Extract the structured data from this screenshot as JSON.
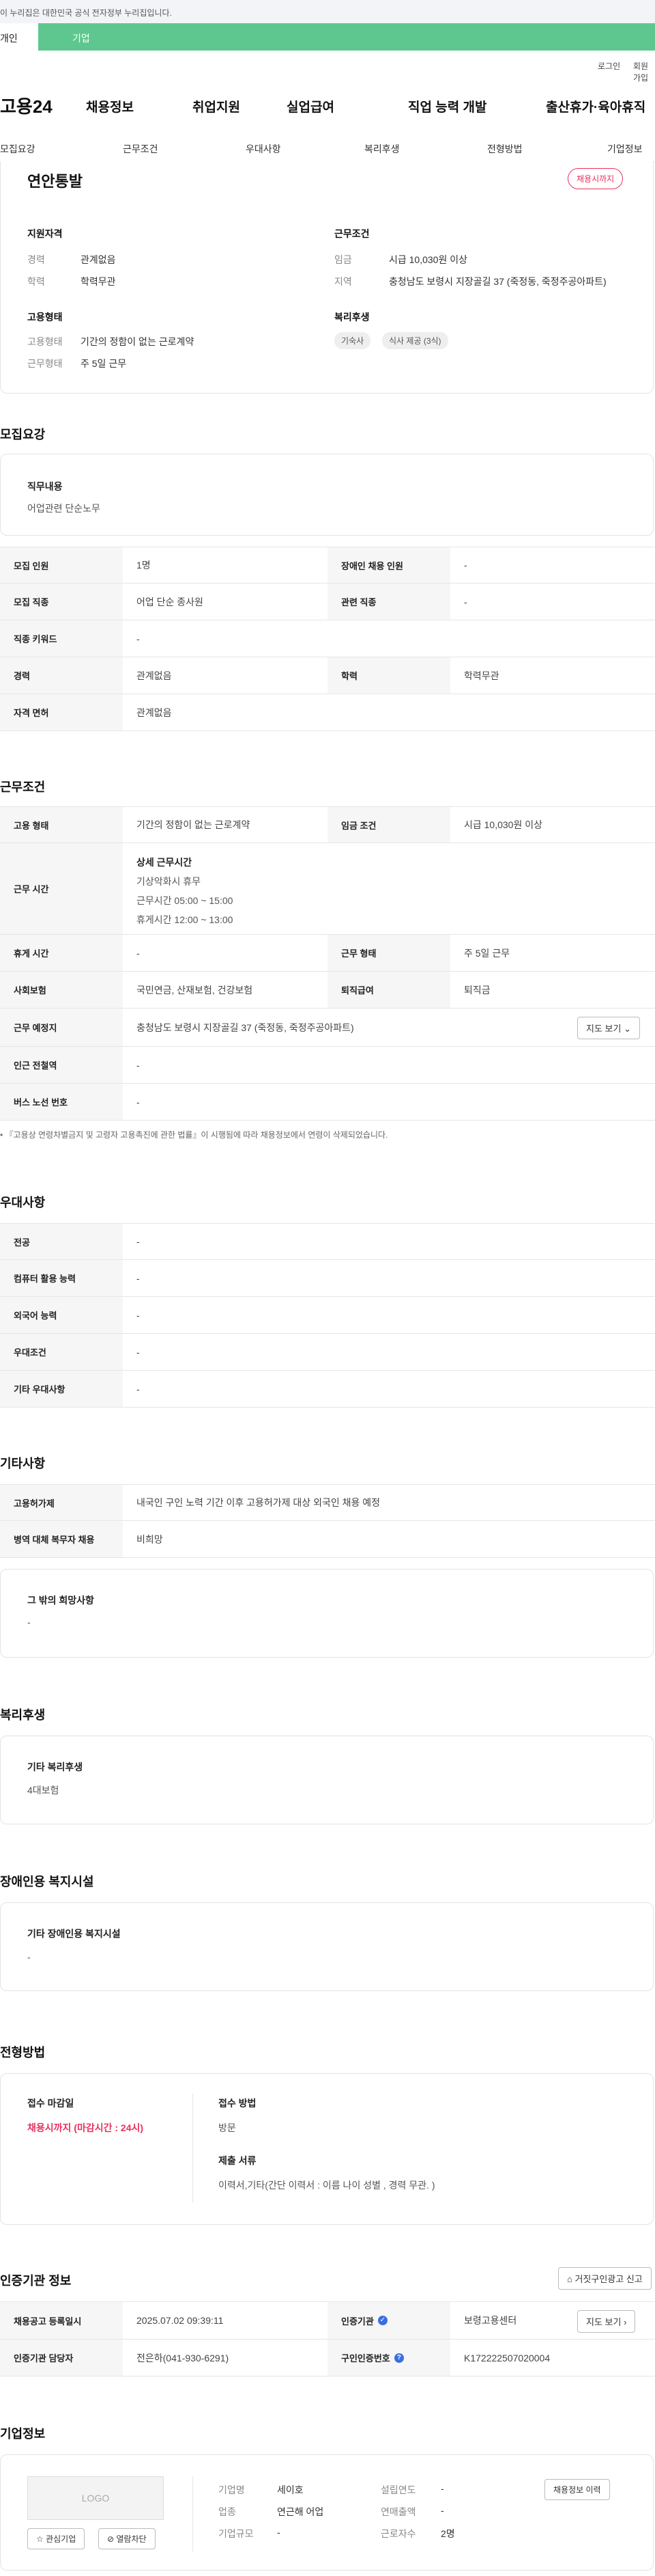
{
  "gov_banner": "이 누리집은 대한민국 공식 전자정부 누리집입니다.",
  "top_tabs": [
    "개인",
    "기업"
  ],
  "utility": {
    "login": "로그인",
    "signup": "회원가입"
  },
  "logo": "고용24",
  "gnb": [
    "채용정보",
    "취업지원",
    "실업급여",
    "직업 능력 개발",
    "출산휴가·육아휴직"
  ],
  "subnav": [
    "모집요강",
    "근무조건",
    "우대사항",
    "복리후생",
    "전형방법",
    "기업정보"
  ],
  "summary": {
    "title": "연안통발",
    "status_pill": "채용시까지",
    "qual_head": "지원자격",
    "career_k": "경력",
    "career_v": "관계없음",
    "edu_k": "학력",
    "edu_v": "학력무관",
    "emp_head": "고용형태",
    "emp_type_k": "고용형태",
    "emp_type_v": "기간의 정함이 없는 근로계약",
    "work_type_k": "근무형태",
    "work_type_v": "주 5일 근무",
    "cond_head": "근무조건",
    "wage_k": "임금",
    "wage_v": "시급 10,030원 이상",
    "region_k": "지역",
    "region_v": "충청남도 보령시 지장골길 37 (죽정동, 죽정주공아파트)",
    "welfare_head": "복리후생",
    "chips": [
      "기숙사",
      "식사 제공 (3식)"
    ]
  },
  "recruit": {
    "title": "모집요강",
    "duty_head": "직무내용",
    "duty_val": "어업관련 단순노무",
    "rows": [
      {
        "k1": "모집 인원",
        "v1": "1명",
        "k2": "장애인 채용 인원",
        "v2": "-"
      },
      {
        "k1": "모집 직종",
        "v1": "어업 단순 종사원",
        "k2": "관련 직종",
        "v2": "-"
      },
      {
        "k1": "직종 키워드",
        "v1": "-"
      },
      {
        "k1": "경력",
        "v1": "관계없음",
        "k2": "학력",
        "v2": "학력무관"
      },
      {
        "k1": "자격 면허",
        "v1": "관계없음"
      }
    ]
  },
  "conditions": {
    "title": "근무조건",
    "row1": {
      "k1": "고용 형태",
      "v1": "기간의 정함이 없는 근로계약",
      "k2": "임금 조건",
      "v2": "시급 10,030원 이상"
    },
    "hours_k": "근무 시간",
    "hours_head": "상세 근무시간",
    "hours_lines": [
      "기상악화시 휴무",
      "근무시간 05:00 ~ 15:00",
      "휴게시간 12:00 ~ 13:00"
    ],
    "row3": {
      "k1": "휴게 시간",
      "v1": "-",
      "k2": "근무 형태",
      "v2": "주 5일 근무"
    },
    "row4": {
      "k1": "사회보험",
      "v1": "국민연금, 산재보험, 건강보험",
      "k2": "퇴직급여",
      "v2": "퇴직금"
    },
    "row5": {
      "k1": "근무 예정지",
      "v1": "충청남도 보령시 지장골길 37 (죽정동, 죽정주공아파트)",
      "btn": "지도 보기"
    },
    "row6": {
      "k1": "인근 전철역",
      "v1": "-"
    },
    "row7": {
      "k1": "버스 노선 번호",
      "v1": "-"
    },
    "note": "『고용상 연령차별금지 및 고령자 고용촉진에 관한 법률』이 시행됨에 따라 채용정보에서 연령이 삭제되었습니다."
  },
  "preference": {
    "title": "우대사항",
    "rows": [
      {
        "k": "전공",
        "v": "-"
      },
      {
        "k": "컴퓨터 활용 능력",
        "v": "-"
      },
      {
        "k": "외국어 능력",
        "v": "-"
      },
      {
        "k": "우대조건",
        "v": "-"
      },
      {
        "k": "기타 우대사항",
        "v": "-"
      }
    ]
  },
  "etc": {
    "title": "기타사항",
    "rows": [
      {
        "k": "고용허가제",
        "v": "내국인 구인 노력 기간 이후 고용허가제 대상 외국인 채용 예정"
      },
      {
        "k": "병역 대체 복무자 채용",
        "v": "비희망"
      }
    ],
    "box_head": "그 밖의 희망사항",
    "box_val": "-"
  },
  "welfare": {
    "title": "복리후생",
    "head": "기타 복리후생",
    "val": "4대보험"
  },
  "disability": {
    "title": "장애인용 복지시설",
    "head": "기타 장애인용 복지시설",
    "val": "-"
  },
  "selection": {
    "title": "전형방법",
    "deadline_head": "접수 마감일",
    "deadline_val": "채용시까지 (마감시간 : 24시)",
    "method_head": "접수 방법",
    "method_val": "방문",
    "docs_head": "제출 서류",
    "docs_val": "이력서,기타(간단 이력서 : 이름 나이 성별 , 경력 무관. )"
  },
  "agency": {
    "title": "인증기관 정보",
    "report_btn": "거짓구인광고 신고",
    "r1": {
      "k1": "채용공고 등록일시",
      "v1": "2025.07.02 09:39:11",
      "k2": "인증기관",
      "v2": "보령고용센터",
      "btn": "지도 보기"
    },
    "r2": {
      "k1": "인증기관 담당자",
      "v1": "전은하(041-930-6291)",
      "k2": "구인인증번호",
      "v2": "K172222507020004"
    }
  },
  "company": {
    "title": "기업정보",
    "logo": "LOGO",
    "fav_btn": "관심기업",
    "block_btn": "열람차단",
    "name_k": "기업명",
    "name_v": "세이호",
    "ind_k": "업종",
    "ind_v": "연근해 어업",
    "size_k": "기업규모",
    "size_v": "-",
    "est_k": "설립연도",
    "est_v": "-",
    "rev_k": "연매출액",
    "rev_v": "-",
    "emp_k": "근로자수",
    "emp_v": "2명",
    "info_btn": "채용정보 이력"
  },
  "colors": {
    "accent_green": "#5ec78f",
    "accent_red": "#e8315f",
    "badge_blue": "#3b6fe0"
  }
}
